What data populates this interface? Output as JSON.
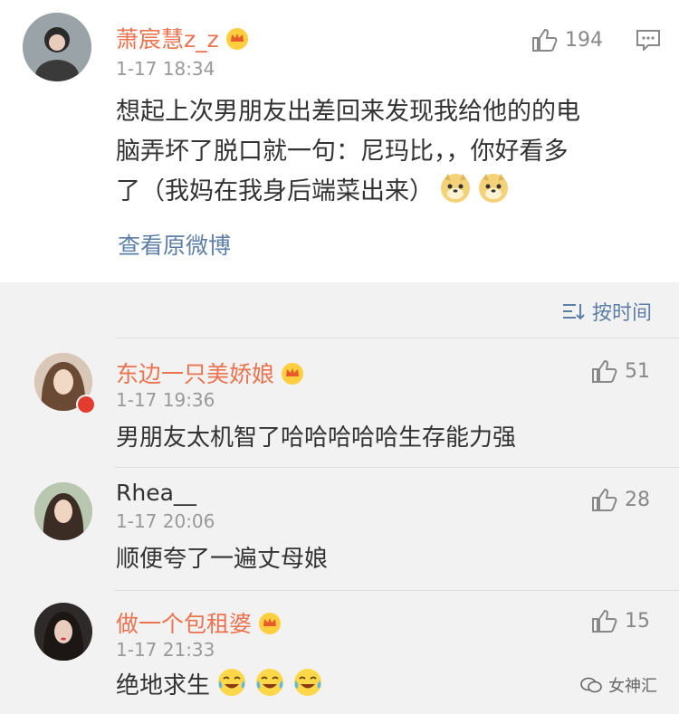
{
  "main_post": {
    "user": "萧宸慧z_z",
    "time": "1-17 18:34",
    "likes": "194",
    "text_lines": [
      "想起上次男朋友出差回来发现我给他的的电",
      "脑弄坏了脱口就一句：尼玛比，，你好看多",
      "了（我妈在我身后端菜出来）"
    ],
    "view_original": "查看原微博",
    "emojis": [
      "doge-emoji",
      "doge-emoji"
    ]
  },
  "sort": {
    "label": "按时间",
    "icon": "sort-icon"
  },
  "replies": [
    {
      "user": "东边一只美娇娘",
      "vip": true,
      "time": "1-17 19:36",
      "likes": "51",
      "text": "男朋友太机智了哈哈哈哈哈生存能力强"
    },
    {
      "user": "Rhea__",
      "vip": false,
      "time": "1-17 20:06",
      "likes": "28",
      "text": "顺便夸了一遍丈母娘"
    },
    {
      "user": "做一个包租婆",
      "vip": true,
      "time": "1-17 21:33",
      "likes": "15",
      "text": "绝地求生"
    }
  ],
  "watermark": {
    "text": "女神汇"
  },
  "colors": {
    "username": "#eb7350",
    "link": "#5d7fa6",
    "background": "#f2f2f2"
  }
}
